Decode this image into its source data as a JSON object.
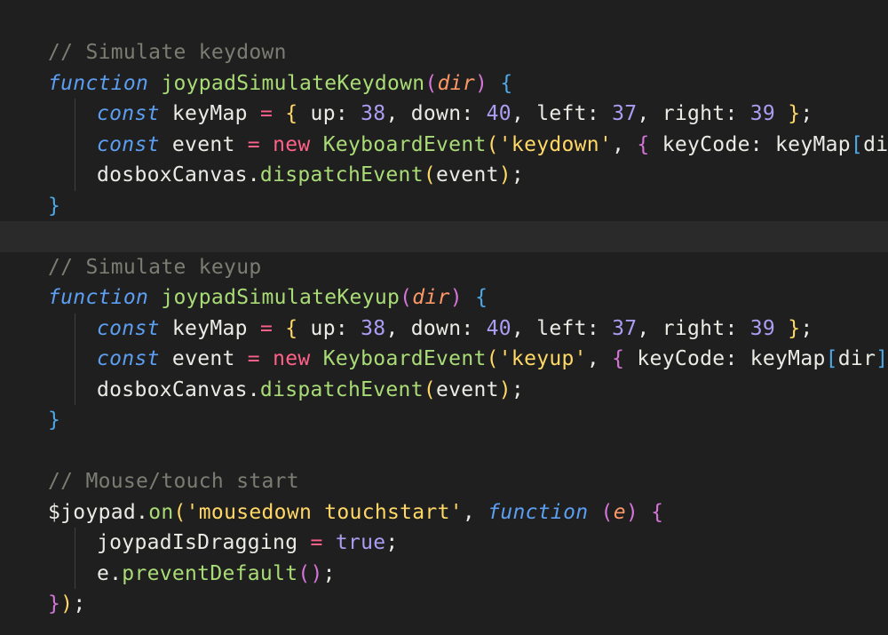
{
  "editor": {
    "background": "#1f1f1f",
    "highlight_line_background": "#2a2a2a",
    "token_colors": {
      "comment": "#7c7c73",
      "keyword": "#5c9ff2",
      "function": "#a9dc76",
      "parameter": "#fc9867",
      "string": "#ffd866",
      "number": "#ab9df2",
      "operator": "#ff6188",
      "text": "#ebebe6"
    },
    "lines": [
      {
        "indent": 0,
        "tokens": [
          {
            "t": "// Simulate keydown",
            "c": "comment"
          }
        ]
      },
      {
        "indent": 0,
        "tokens": [
          {
            "t": "function",
            "c": "keyword"
          },
          {
            "t": " ",
            "c": "plain"
          },
          {
            "t": "joypadSimulateKeydown",
            "c": "func"
          },
          {
            "t": "(",
            "c": "paren2"
          },
          {
            "t": "dir",
            "c": "param"
          },
          {
            "t": ")",
            "c": "paren2"
          },
          {
            "t": " ",
            "c": "plain"
          },
          {
            "t": "{",
            "c": "paren3"
          }
        ]
      },
      {
        "indent": 1,
        "tokens": [
          {
            "t": "const",
            "c": "keyword"
          },
          {
            "t": " keyMap ",
            "c": "plain"
          },
          {
            "t": "=",
            "c": "op"
          },
          {
            "t": " ",
            "c": "plain"
          },
          {
            "t": "{",
            "c": "paren1"
          },
          {
            "t": " up: ",
            "c": "plain"
          },
          {
            "t": "38",
            "c": "num"
          },
          {
            "t": ", down: ",
            "c": "plain"
          },
          {
            "t": "40",
            "c": "num"
          },
          {
            "t": ", left: ",
            "c": "plain"
          },
          {
            "t": "37",
            "c": "num"
          },
          {
            "t": ", right: ",
            "c": "plain"
          },
          {
            "t": "39",
            "c": "num"
          },
          {
            "t": " ",
            "c": "plain"
          },
          {
            "t": "}",
            "c": "paren1"
          },
          {
            "t": ";",
            "c": "plain"
          }
        ]
      },
      {
        "indent": 1,
        "tokens": [
          {
            "t": "const",
            "c": "keyword"
          },
          {
            "t": " event ",
            "c": "plain"
          },
          {
            "t": "=",
            "c": "op"
          },
          {
            "t": " ",
            "c": "plain"
          },
          {
            "t": "new",
            "c": "op"
          },
          {
            "t": " ",
            "c": "plain"
          },
          {
            "t": "KeyboardEvent",
            "c": "func"
          },
          {
            "t": "(",
            "c": "paren1"
          },
          {
            "t": "'keydown'",
            "c": "string"
          },
          {
            "t": ", ",
            "c": "plain"
          },
          {
            "t": "{",
            "c": "paren2"
          },
          {
            "t": " keyCode: keyMap",
            "c": "plain"
          },
          {
            "t": "[",
            "c": "paren3"
          },
          {
            "t": "dir",
            "c": "plain"
          },
          {
            "t": "]",
            "c": "paren3"
          }
        ]
      },
      {
        "indent": 1,
        "tokens": [
          {
            "t": "dosboxCanvas.",
            "c": "plain"
          },
          {
            "t": "dispatchEvent",
            "c": "func"
          },
          {
            "t": "(",
            "c": "paren1"
          },
          {
            "t": "event",
            "c": "plain"
          },
          {
            "t": ")",
            "c": "paren1"
          },
          {
            "t": ";",
            "c": "plain"
          }
        ]
      },
      {
        "indent": 0,
        "tokens": [
          {
            "t": "}",
            "c": "paren3"
          }
        ]
      },
      {
        "indent": 0,
        "highlight": true,
        "tokens": []
      },
      {
        "indent": 0,
        "tokens": [
          {
            "t": "// Simulate keyup",
            "c": "comment"
          }
        ]
      },
      {
        "indent": 0,
        "tokens": [
          {
            "t": "function",
            "c": "keyword"
          },
          {
            "t": " ",
            "c": "plain"
          },
          {
            "t": "joypadSimulateKeyup",
            "c": "func"
          },
          {
            "t": "(",
            "c": "paren2"
          },
          {
            "t": "dir",
            "c": "param"
          },
          {
            "t": ")",
            "c": "paren2"
          },
          {
            "t": " ",
            "c": "plain"
          },
          {
            "t": "{",
            "c": "paren3"
          }
        ]
      },
      {
        "indent": 1,
        "tokens": [
          {
            "t": "const",
            "c": "keyword"
          },
          {
            "t": " keyMap ",
            "c": "plain"
          },
          {
            "t": "=",
            "c": "op"
          },
          {
            "t": " ",
            "c": "plain"
          },
          {
            "t": "{",
            "c": "paren1"
          },
          {
            "t": " up: ",
            "c": "plain"
          },
          {
            "t": "38",
            "c": "num"
          },
          {
            "t": ", down: ",
            "c": "plain"
          },
          {
            "t": "40",
            "c": "num"
          },
          {
            "t": ", left: ",
            "c": "plain"
          },
          {
            "t": "37",
            "c": "num"
          },
          {
            "t": ", right: ",
            "c": "plain"
          },
          {
            "t": "39",
            "c": "num"
          },
          {
            "t": " ",
            "c": "plain"
          },
          {
            "t": "}",
            "c": "paren1"
          },
          {
            "t": ";",
            "c": "plain"
          }
        ]
      },
      {
        "indent": 1,
        "tokens": [
          {
            "t": "const",
            "c": "keyword"
          },
          {
            "t": " event ",
            "c": "plain"
          },
          {
            "t": "=",
            "c": "op"
          },
          {
            "t": " ",
            "c": "plain"
          },
          {
            "t": "new",
            "c": "op"
          },
          {
            "t": " ",
            "c": "plain"
          },
          {
            "t": "KeyboardEvent",
            "c": "func"
          },
          {
            "t": "(",
            "c": "paren1"
          },
          {
            "t": "'keyup'",
            "c": "string"
          },
          {
            "t": ", ",
            "c": "plain"
          },
          {
            "t": "{",
            "c": "paren2"
          },
          {
            "t": " keyCode: keyMap",
            "c": "plain"
          },
          {
            "t": "[",
            "c": "paren3"
          },
          {
            "t": "dir",
            "c": "plain"
          },
          {
            "t": "]",
            "c": "paren3"
          },
          {
            "t": ",",
            "c": "plain"
          }
        ]
      },
      {
        "indent": 1,
        "tokens": [
          {
            "t": "dosboxCanvas.",
            "c": "plain"
          },
          {
            "t": "dispatchEvent",
            "c": "func"
          },
          {
            "t": "(",
            "c": "paren1"
          },
          {
            "t": "event",
            "c": "plain"
          },
          {
            "t": ")",
            "c": "paren1"
          },
          {
            "t": ";",
            "c": "plain"
          }
        ]
      },
      {
        "indent": 0,
        "tokens": [
          {
            "t": "}",
            "c": "paren3"
          }
        ]
      },
      {
        "indent": 0,
        "tokens": []
      },
      {
        "indent": 0,
        "tokens": [
          {
            "t": "// Mouse/touch start",
            "c": "comment"
          }
        ]
      },
      {
        "indent": 0,
        "tokens": [
          {
            "t": "$joypad.",
            "c": "plain"
          },
          {
            "t": "on",
            "c": "func"
          },
          {
            "t": "(",
            "c": "paren1"
          },
          {
            "t": "'mousedown touchstart'",
            "c": "string"
          },
          {
            "t": ", ",
            "c": "plain"
          },
          {
            "t": "function",
            "c": "keyword"
          },
          {
            "t": " ",
            "c": "plain"
          },
          {
            "t": "(",
            "c": "paren2"
          },
          {
            "t": "e",
            "c": "param"
          },
          {
            "t": ")",
            "c": "paren2"
          },
          {
            "t": " ",
            "c": "plain"
          },
          {
            "t": "{",
            "c": "paren2"
          }
        ]
      },
      {
        "indent": 1,
        "tokens": [
          {
            "t": "joypadIsDragging ",
            "c": "plain"
          },
          {
            "t": "=",
            "c": "op"
          },
          {
            "t": " ",
            "c": "plain"
          },
          {
            "t": "true",
            "c": "bool"
          },
          {
            "t": ";",
            "c": "plain"
          }
        ]
      },
      {
        "indent": 1,
        "tokens": [
          {
            "t": "e.",
            "c": "plain"
          },
          {
            "t": "preventDefault",
            "c": "func"
          },
          {
            "t": "()",
            "c": "paren2"
          },
          {
            "t": ";",
            "c": "plain"
          }
        ]
      },
      {
        "indent": 0,
        "tokens": [
          {
            "t": "}",
            "c": "paren2"
          },
          {
            "t": ")",
            "c": "paren1"
          },
          {
            "t": ";",
            "c": "plain"
          }
        ]
      }
    ]
  }
}
